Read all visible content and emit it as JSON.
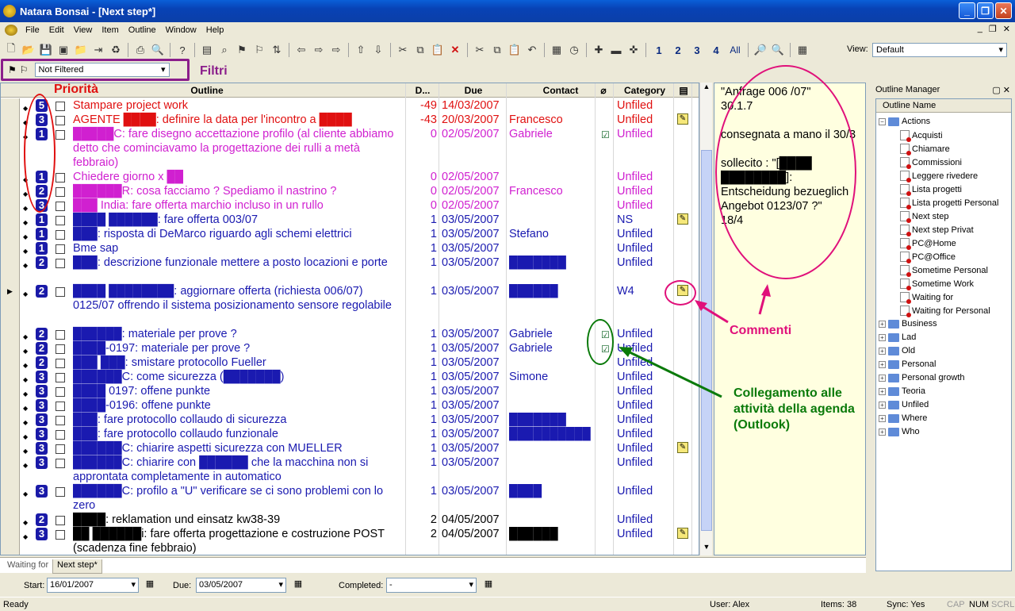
{
  "window": {
    "title": "Natara Bonsai - [Next step*]"
  },
  "menu": [
    "File",
    "Edit",
    "View",
    "Item",
    "Outline",
    "Window",
    "Help"
  ],
  "toolbar": {
    "levels": [
      "1",
      "2",
      "3",
      "4",
      "All"
    ],
    "view_label": "View:",
    "view_value": "Default"
  },
  "filter": {
    "value": "Not Filtered",
    "annotation": "Filtri"
  },
  "columns": {
    "outline": "Outline",
    "d": "D...",
    "due": "Due",
    "contact": "Contact",
    "category": "Category"
  },
  "rows": [
    {
      "prio": "5",
      "text": "Stampare  project work",
      "color": "red",
      "d": "-49",
      "due": "14/03/2007",
      "contact": "",
      "cat": "Unfiled",
      "note": false,
      "link": false,
      "lines": 1
    },
    {
      "prio": "3",
      "text": "AGENTE ████: definire la data per l'incontro a ████",
      "color": "red",
      "d": "-43",
      "due": "20/03/2007",
      "contact": "Francesco",
      "cat": "Unfiled",
      "note": true,
      "link": false,
      "lines": 1
    },
    {
      "prio": "1",
      "text": "█████C: fare disegno accettazione profilo (al cliente abbiamo detto che cominciavamo la progettazione dei rulli a metà febbraio)",
      "color": "mag",
      "d": "0",
      "due": "02/05/2007",
      "contact": "Gabriele",
      "cat": "Unfiled",
      "note": false,
      "link": true,
      "lines": 3
    },
    {
      "prio": "1",
      "text": "Chiedere giorno x ██",
      "color": "mag",
      "d": "0",
      "due": "02/05/2007",
      "contact": "",
      "cat": "Unfiled",
      "note": false,
      "link": false,
      "lines": 1
    },
    {
      "prio": "2",
      "text": "██████R: cosa facciamo ? Spediamo il nastrino ?",
      "color": "mag",
      "d": "0",
      "due": "02/05/2007",
      "contact": "Francesco",
      "cat": "Unfiled",
      "note": false,
      "link": false,
      "lines": 1
    },
    {
      "prio": "3",
      "text": "███ India: fare offerta marchio incluso in un rullo",
      "color": "mag",
      "d": "0",
      "due": "02/05/2007",
      "contact": "",
      "cat": "Unfiled",
      "note": false,
      "link": false,
      "lines": 1
    },
    {
      "prio": "1",
      "text": "████ ██████: fare offerta 003/07",
      "color": "blue",
      "d": "1",
      "due": "03/05/2007",
      "contact": "",
      "cat": "NS",
      "note": true,
      "link": false,
      "lines": 1
    },
    {
      "prio": "1",
      "text": "███: risposta di DeMarco riguardo agli schemi elettrici",
      "color": "blue",
      "d": "1",
      "due": "03/05/2007",
      "contact": "Stefano",
      "cat": "Unfiled",
      "note": false,
      "link": false,
      "lines": 1
    },
    {
      "prio": "1",
      "text": "Bme sap",
      "color": "blue",
      "d": "1",
      "due": "03/05/2007",
      "contact": "",
      "cat": "Unfiled",
      "note": false,
      "link": false,
      "lines": 1
    },
    {
      "prio": "2",
      "text": "███: descrizione funzionale mettere a posto locazioni e porte",
      "color": "blue",
      "d": "1",
      "due": "03/05/2007",
      "contact": "███████",
      "cat": "Unfiled",
      "note": false,
      "link": false,
      "lines": 2
    },
    {
      "prio": "2",
      "text": "████ ████████: aggiornare offerta (richiesta 006/07) 0125/07 offrendo il sistema posizionamento sensore regolabile",
      "color": "blue",
      "d": "1",
      "due": "03/05/2007",
      "contact": "██████",
      "cat": "W4",
      "note": true,
      "link": false,
      "lines": 3,
      "current": true
    },
    {
      "prio": "2",
      "text": "██████: materiale per prove ?",
      "color": "blue",
      "d": "1",
      "due": "03/05/2007",
      "contact": "Gabriele",
      "cat": "Unfiled",
      "note": false,
      "link": true,
      "lines": 1
    },
    {
      "prio": "2",
      "text": "████-0197: materiale per prove ?",
      "color": "blue",
      "d": "1",
      "due": "03/05/2007",
      "contact": "Gabriele",
      "cat": "Unfiled",
      "note": false,
      "link": true,
      "lines": 1
    },
    {
      "prio": "2",
      "text": "███ ███: smistare protocollo Fueller",
      "color": "blue",
      "d": "1",
      "due": "03/05/2007",
      "contact": "",
      "cat": "Unfiled",
      "note": false,
      "link": false,
      "lines": 1
    },
    {
      "prio": "3",
      "text": "██████C: come sicurezza (███████)",
      "color": "blue",
      "d": "1",
      "due": "03/05/2007",
      "contact": "Simone",
      "cat": "Unfiled",
      "note": false,
      "link": false,
      "lines": 1
    },
    {
      "prio": "3",
      "text": "████ 0197: offene punkte",
      "color": "blue",
      "d": "1",
      "due": "03/05/2007",
      "contact": "",
      "cat": "Unfiled",
      "note": false,
      "link": false,
      "lines": 1
    },
    {
      "prio": "3",
      "text": "████-0196: offene punkte",
      "color": "blue",
      "d": "1",
      "due": "03/05/2007",
      "contact": "",
      "cat": "Unfiled",
      "note": false,
      "link": false,
      "lines": 1
    },
    {
      "prio": "3",
      "text": "███: fare protocollo collaudo di sicurezza",
      "color": "blue",
      "d": "1",
      "due": "03/05/2007",
      "contact": "███████",
      "cat": "Unfiled",
      "note": false,
      "link": false,
      "lines": 1
    },
    {
      "prio": "3",
      "text": "███: fare protocollo collaudo funzionale",
      "color": "blue",
      "d": "1",
      "due": "03/05/2007",
      "contact": "██████████",
      "cat": "Unfiled",
      "note": false,
      "link": false,
      "lines": 1
    },
    {
      "prio": "3",
      "text": "██████C: chiarire aspetti sicurezza con MUELLER",
      "color": "blue",
      "d": "1",
      "due": "03/05/2007",
      "contact": "",
      "cat": "Unfiled",
      "note": true,
      "link": false,
      "lines": 1
    },
    {
      "prio": "3",
      "text": "██████C: chiarire con ██████ che la macchina non si approntata completamente in automatico",
      "color": "blue",
      "d": "1",
      "due": "03/05/2007",
      "contact": "",
      "cat": "Unfiled",
      "note": false,
      "link": false,
      "lines": 2
    },
    {
      "prio": "3",
      "text": "██████C: profilo a \"U\" verificare se ci sono problemi con lo zero",
      "color": "blue",
      "d": "1",
      "due": "03/05/2007",
      "contact": "████",
      "cat": "Unfiled",
      "note": false,
      "link": false,
      "lines": 2
    },
    {
      "prio": "2",
      "text": "████: reklamation und einsatz kw38-39",
      "color": "black",
      "d": "2",
      "due": "04/05/2007",
      "contact": "",
      "cat": "Unfiled",
      "note": false,
      "link": false,
      "lines": 1
    },
    {
      "prio": "3",
      "text": "██ ██████i: fare offerta progettazione e costruzione POST (scadenza fine febbraio)",
      "color": "black",
      "d": "2",
      "due": "04/05/2007",
      "contact": "██████",
      "cat": "Unfiled",
      "note": true,
      "link": false,
      "lines": 2
    }
  ],
  "notes": "\"Anfrage 006 /07\"\n30.1.7\n\nconsegnata a mano il 30/3\n\nsollecito : \"[████ ████████]: Entscheidung bezueglich Angebot 0123/07 ?\"\n18/4",
  "annotations": {
    "priority": "Priorità",
    "comments": "Commenti",
    "link": "Collegamento alle attività della agenda (Outlook)"
  },
  "outline_manager": {
    "title": "Outline Manager",
    "header": "Outline Name",
    "actions_label": "Actions",
    "actions": [
      "Acquisti",
      "Chiamare",
      "Commissioni",
      "Leggere rivedere",
      "Lista progetti",
      "Lista progetti Personal",
      "Next step",
      "Next step Privat",
      "PC@Home",
      "PC@Office",
      "Sometime Personal",
      "Sometime Work",
      "Waiting for",
      "Waiting for Personal"
    ],
    "folders": [
      "Business",
      "Lad",
      "Old",
      "Personal",
      "Personal growth",
      "Teoria",
      "Unfiled",
      "Where",
      "Who"
    ]
  },
  "tabs": [
    "Waiting for",
    "Next step*"
  ],
  "bottom": {
    "start_label": "Start:",
    "start": "16/01/2007",
    "due_label": "Due:",
    "due": "03/05/2007",
    "completed_label": "Completed:",
    "completed": "-"
  },
  "status": {
    "ready": "Ready",
    "user": "User: Alex",
    "items": "Items: 38",
    "sync": "Sync: Yes",
    "cap": "CAP",
    "num": "NUM",
    "scrl": "SCRL"
  }
}
